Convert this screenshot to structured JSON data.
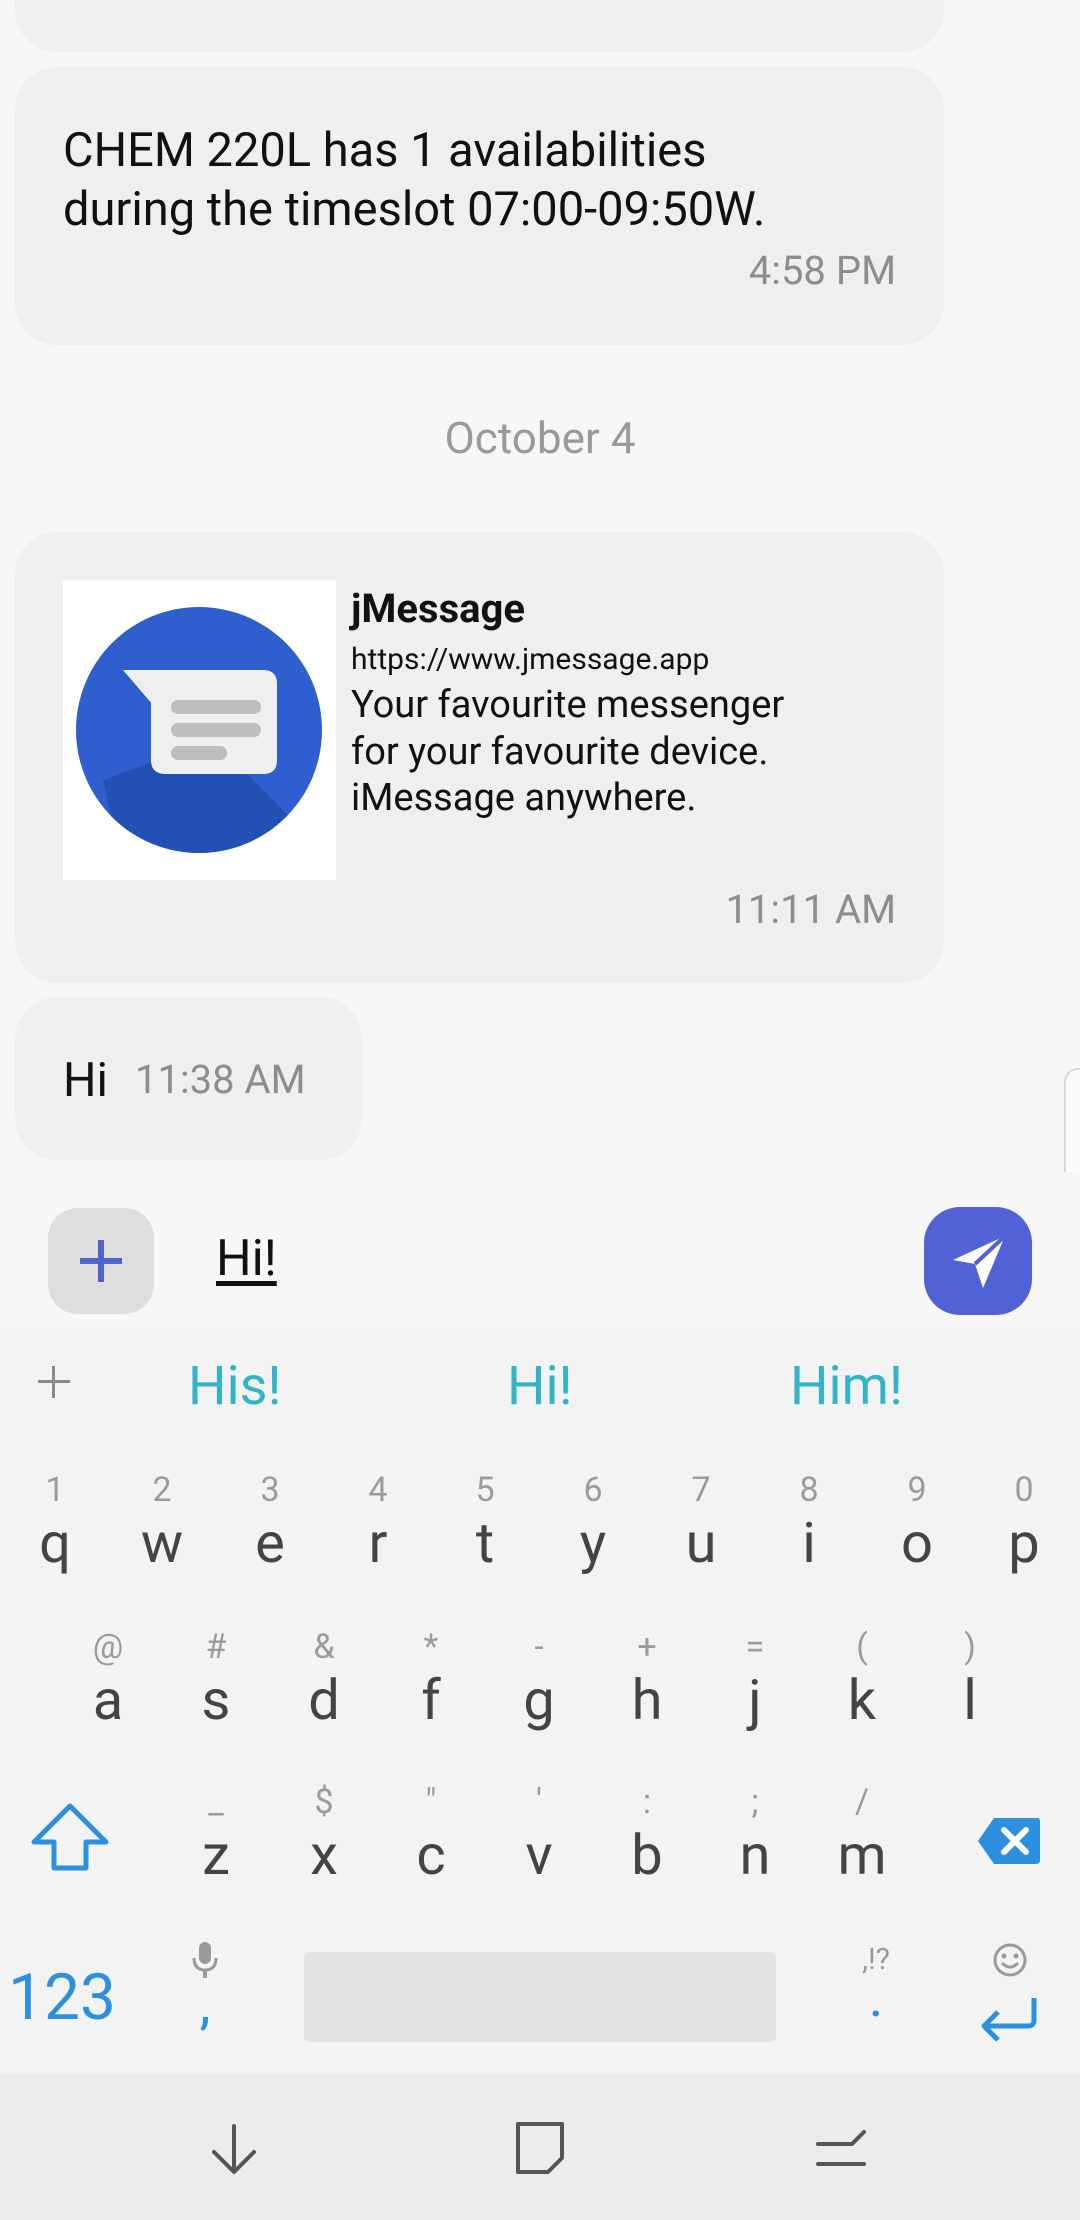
{
  "colors": {
    "accent": "#5062d6",
    "suggestion": "#31b3c8",
    "key_blue": "#2c8fe0"
  },
  "messages": {
    "m1": {
      "line1": "CHEM 220L has 1 availabilities",
      "line2": "during the timeslot 07:00-09:50W.",
      "time": "4:58 PM"
    },
    "date_divider": "October 4",
    "link": {
      "title": "jMessage",
      "url": "https://www.jmessage.app",
      "desc1": "Your favourite messenger",
      "desc2": "for your favourite device.",
      "desc3": "iMessage anywhere.",
      "time": "11:11 AM"
    },
    "m3": {
      "text": "Hi",
      "time": "11:38 AM"
    }
  },
  "composer": {
    "value": "Hi!",
    "attach_icon": "plus-icon",
    "send_icon": "send-icon"
  },
  "keyboard": {
    "suggestions": [
      "His!",
      "Hi!",
      "Him!"
    ],
    "row1": [
      [
        "1",
        "q"
      ],
      [
        "2",
        "w"
      ],
      [
        "3",
        "e"
      ],
      [
        "4",
        "r"
      ],
      [
        "5",
        "t"
      ],
      [
        "6",
        "y"
      ],
      [
        "7",
        "u"
      ],
      [
        "8",
        "i"
      ],
      [
        "9",
        "o"
      ],
      [
        "0",
        "p"
      ]
    ],
    "row2": [
      [
        "@",
        "a"
      ],
      [
        "#",
        "s"
      ],
      [
        "&",
        "d"
      ],
      [
        "*",
        "f"
      ],
      [
        "-",
        "g"
      ],
      [
        "+",
        "h"
      ],
      [
        "=",
        "j"
      ],
      [
        "(",
        "k"
      ],
      [
        ")",
        "l"
      ]
    ],
    "row3": [
      [
        "_",
        "z"
      ],
      [
        "$",
        "x"
      ],
      [
        "\"",
        "c"
      ],
      [
        "'",
        "v"
      ],
      [
        ":",
        "b"
      ],
      [
        ";",
        "n"
      ],
      [
        "/",
        "m"
      ]
    ],
    "numbers_label": "123",
    "comma": ",",
    "period_hint": ",!?",
    "period": "."
  }
}
